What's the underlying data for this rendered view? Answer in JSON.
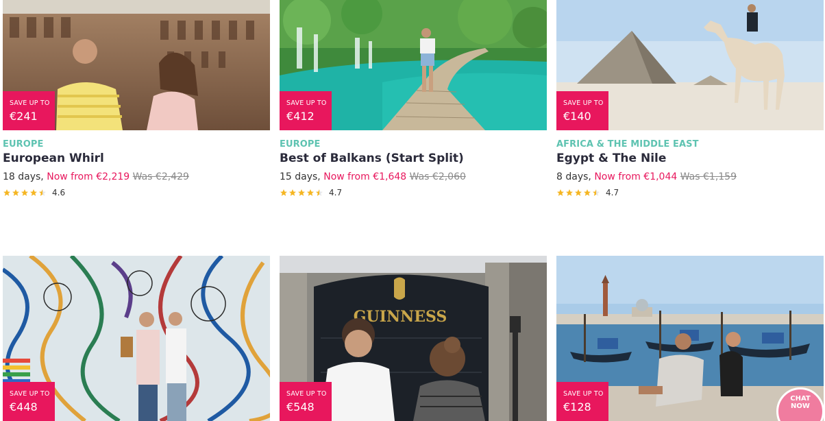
{
  "colors": {
    "accent": "#e8175d",
    "region": "#5ec3b1",
    "star": "#f5b623"
  },
  "tours": [
    {
      "save_label": "SAVE UP TO",
      "save_amount": "€241",
      "region": "EUROPE",
      "title": "European Whirl",
      "days": "18 days,",
      "now_from": "Now from €2,219",
      "was": "Was €2,429",
      "rating": "4.6",
      "stars": 4.5,
      "photo": "colosseum"
    },
    {
      "save_label": "SAVE UP TO",
      "save_amount": "€412",
      "region": "EUROPE",
      "title": "Best of Balkans (Start Split)",
      "days": "15 days,",
      "now_from": "Now from €1,648",
      "was": "Was €2,060",
      "rating": "4.7",
      "stars": 4.5,
      "photo": "waterfall-boardwalk"
    },
    {
      "save_label": "SAVE UP TO",
      "save_amount": "€140",
      "region": "AFRICA & THE MIDDLE EAST",
      "title": "Egypt & The Nile",
      "days": "8 days,",
      "now_from": "Now from €1,044",
      "was": "Was €1,159",
      "rating": "4.7",
      "stars": 4.5,
      "photo": "pyramid-camel"
    },
    {
      "save_label": "SAVE UP TO",
      "save_amount": "€448",
      "photo": "graffiti-wall"
    },
    {
      "save_label": "SAVE UP TO",
      "save_amount": "€548",
      "photo": "guinness-gate",
      "sign": "GUINNESS"
    },
    {
      "save_label": "SAVE UP TO",
      "save_amount": "€128",
      "photo": "venice-gondolas"
    }
  ],
  "chat": {
    "line1": "CHAT",
    "line2": "NOW"
  }
}
